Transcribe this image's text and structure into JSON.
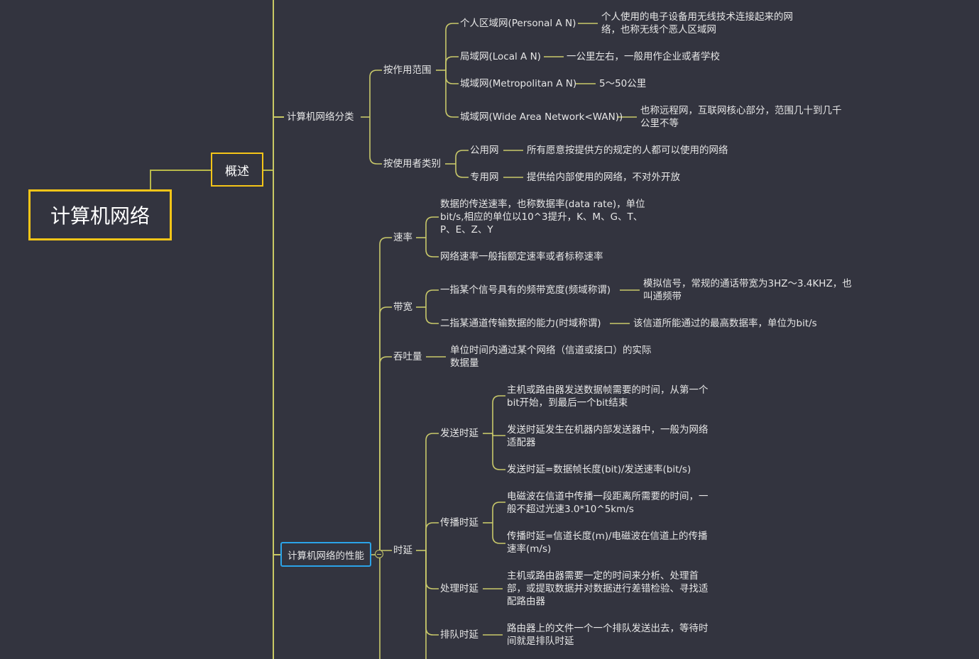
{
  "root": "计算机网络",
  "overview": "概述",
  "classification": {
    "label": "计算机网络分类",
    "by_scope": {
      "label": "按作用范围",
      "pan": {
        "name": "个人区域网(Personal A N)",
        "desc": "个人使用的电子设备用无线技术连接起来的网\n络，也称无线个恶人区域网"
      },
      "lan": {
        "name": "局域网(Local A N)",
        "desc": "一公里左右，一般用作企业或者学校"
      },
      "man": {
        "name": "城域网(Metropolitan A N)",
        "desc": "5～50公里"
      },
      "wan": {
        "name": "城域网(Wide Area Network<WAN))",
        "desc": "也称远程网，互联网核心部分，范围几十到几千\n公里不等"
      }
    },
    "by_user": {
      "label": "按使用者类别",
      "public": {
        "name": "公用网",
        "desc": "所有愿意按提供方的规定的人都可以使用的网络"
      },
      "private": {
        "name": "专用网",
        "desc": "提供给内部使用的网络，不对外开放"
      }
    }
  },
  "performance": {
    "label": "计算机网络的性能",
    "rate": {
      "label": "速率",
      "d1": "数据的传送速率，也称数据率(data rate)，单位\nbit/s,相应的单位以10^3提升，K、M、G、T、\nP、E、Z、Y",
      "d2": "网络速率一般指额定速率或者标称速率"
    },
    "bandwidth": {
      "label": "带宽",
      "a": {
        "name": "一指某个信号具有的频带宽度(频域称谓)",
        "desc": "模拟信号，常规的通话带宽为3HZ～3.4KHZ，也\n叫通频带"
      },
      "b": {
        "name": "二指某通道传输数据的能力(时域称谓)",
        "desc": "该信道所能通过的最高数据率，单位为bit/s"
      }
    },
    "throughput": {
      "label": "吞吐量",
      "desc": "单位时间内通过某个网络（信道或接口）的实际\n数据量"
    },
    "delay": {
      "label": "时延",
      "send": {
        "label": "发送时延",
        "d1": "主机或路由器发送数据帧需要的时间，从第一个\nbit开始，到最后一个bit结束",
        "d2": "发送时延发生在机器内部发送器中，一般为网络\n适配器",
        "d3": "发送时延=数据帧长度(bit)/发送速率(bit/s)"
      },
      "prop": {
        "label": "传播时延",
        "d1": "电磁波在信道中传播一段距离所需要的时间，一\n般不超过光速3.0*10^5km/s",
        "d2": "传播时延=信道长度(m)/电磁波在信道上的传播\n速率(m/s)"
      },
      "proc": {
        "label": "处理时延",
        "desc": "主机或路由器需要一定的时间来分析、处理首\n部，或提取数据并对数据进行差错检验、寻找适\n配路由器"
      },
      "queue": {
        "label": "排队时延",
        "desc": "路由器上的文件一个一个排队发送出去，等待时\n间就是排队时延"
      }
    }
  }
}
